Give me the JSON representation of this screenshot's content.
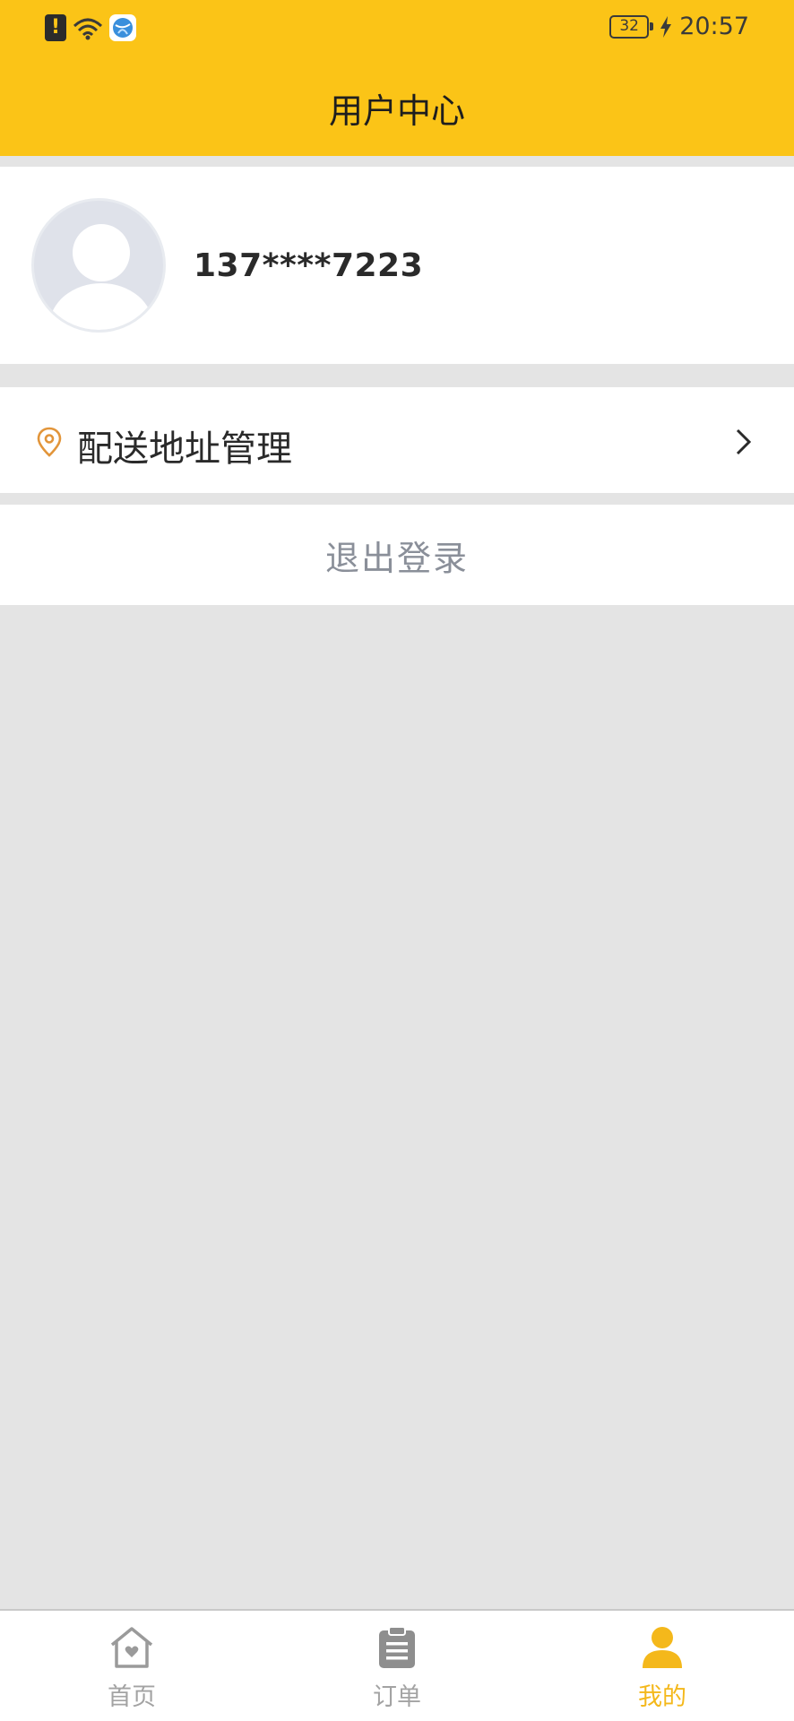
{
  "status_bar": {
    "battery_level": "32",
    "time": "20:57"
  },
  "header": {
    "title": "用户中心"
  },
  "profile": {
    "phone": "137****7223"
  },
  "menu": {
    "address_label": "配送地址管理"
  },
  "logout": {
    "label": "退出登录"
  },
  "tabbar": {
    "tabs": [
      {
        "label": "首页",
        "icon": "home-icon",
        "active": false
      },
      {
        "label": "订单",
        "icon": "orders-icon",
        "active": false
      },
      {
        "label": "我的",
        "icon": "profile-icon",
        "active": true
      }
    ]
  },
  "colors": {
    "brand_yellow": "#fbc417",
    "active_tab": "#f4b81b",
    "pin_orange": "#e2953a"
  }
}
